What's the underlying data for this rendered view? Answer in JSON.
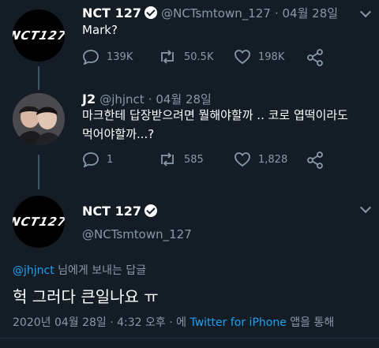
{
  "tweet1": {
    "avatar_text": "NCT127",
    "name": "NCT 127",
    "handle": "@NCTsmtown_127",
    "date": "04월 28일",
    "text": "Mark?",
    "replies": "139K",
    "retweets": "50.5K",
    "likes": "198K"
  },
  "tweet2": {
    "name": "J2",
    "handle": "@jhjnct",
    "date": "04월 28일",
    "text_line1": "마크한테 답장받으려면 뭘해야할까 .. 코로 엽떡이라도",
    "text_line2": "먹어야할까...?",
    "replies": "1",
    "retweets": "585",
    "likes": "1,828"
  },
  "tweet3": {
    "avatar_text": "NCT127",
    "name": "NCT 127",
    "handle": "@NCTsmtown_127",
    "reply_to_user": "@jhjnct",
    "reply_to_suffix": " 님에게 보내는 답글",
    "text": "헉 그러다 큰일나요 ㅠ",
    "timestamp": "2020년 04월 28일 · 4:32 오후 · 에 ",
    "source": "Twitter for iPhone",
    "source_suffix": " 앱을 통해"
  },
  "colors": {
    "background": "#141d26",
    "muted": "#8899a6",
    "link": "#1da1f2"
  }
}
